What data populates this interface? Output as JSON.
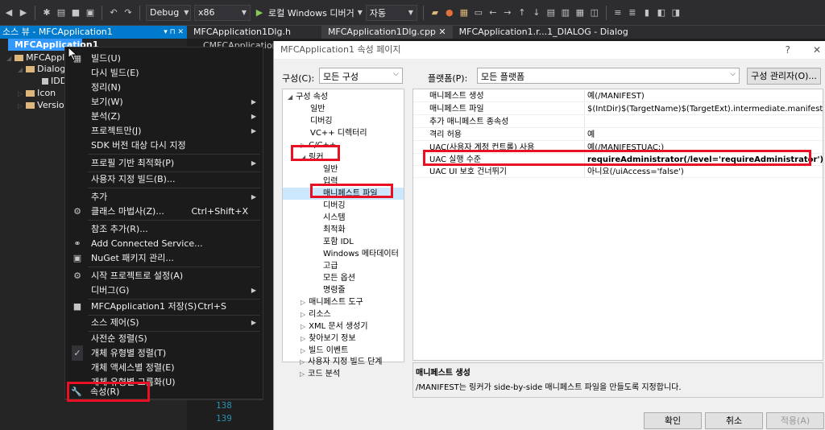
{
  "toolbar": {
    "config": "Debug",
    "platform": "x86",
    "run_label": "로컬 Windows 디버거",
    "run_mode": "자동"
  },
  "solution_explorer": {
    "title": "소스 뷰 - MFCApplication1",
    "items": [
      {
        "label": "MFCApplication1"
      },
      {
        "label": "MFCApplic"
      },
      {
        "label": "Dialog"
      },
      {
        "label": "IDD"
      },
      {
        "label": "Icon"
      },
      {
        "label": "Version"
      }
    ]
  },
  "tabs": [
    {
      "label": "MFCApplication1Dlg.h"
    },
    {
      "label": "MFCApplication1Dlg.cpp"
    },
    {
      "label": "MFCApplication1.r...1_DIALOG - Dialog"
    }
  ],
  "editor": {
    "line_a": "138",
    "line_b": "139",
    "partial_tab": "CMFCApplication1"
  },
  "context_menu": {
    "items": [
      {
        "label": "빌드(U)"
      },
      {
        "label": "다시 빌드(E)"
      },
      {
        "label": "정리(N)"
      },
      {
        "label": "보기(W)"
      },
      {
        "label": "분석(Z)"
      },
      {
        "label": "프로젝트만(J)"
      },
      {
        "label": "SDK 버전 대상 다시 지정"
      },
      {
        "label": "프로필 기반 최적화(P)"
      },
      {
        "label": "사용자 지정 빌드(B)..."
      },
      {
        "label": "추가"
      },
      {
        "label": "클래스 마법사(Z)...",
        "shortcut": "Ctrl+Shift+X"
      },
      {
        "label": "참조 추가(R)..."
      },
      {
        "label": "Add Connected Service..."
      },
      {
        "label": "NuGet 패키지 관리..."
      },
      {
        "label": "시작 프로젝트로 설정(A)"
      },
      {
        "label": "디버그(G)"
      },
      {
        "label": "MFCApplication1 저장(S)",
        "shortcut": "Ctrl+S"
      },
      {
        "label": "소스 제어(S)"
      },
      {
        "label": "사전순 정렬(S)"
      },
      {
        "label": "개체 유형별 정렬(T)"
      },
      {
        "label": "개체 액세스별 정렬(E)"
      },
      {
        "label": "개체 유형별 그룹화(U)"
      },
      {
        "label": "속성(R)"
      }
    ]
  },
  "dialog": {
    "title": "MFCApplication1 속성 페이지",
    "help": "?",
    "close": "✕",
    "config_label": "구성(C):",
    "config_value": "모든 구성",
    "platform_label": "플랫폼(P):",
    "platform_value": "모든 플랫폼",
    "config_manager": "구성 관리자(O)...",
    "tree": [
      "구성 속성",
      "일반",
      "디버깅",
      "VC++ 디렉터리",
      "C/C++",
      "링커",
      "일반",
      "입력",
      "매니페스트 파일",
      "디버깅",
      "시스템",
      "최적화",
      "포함 IDL",
      "Windows 메타데이터",
      "고급",
      "모든 옵션",
      "명령줄",
      "매니페스트 도구",
      "리소스",
      "XML 문서 생성기",
      "찾아보기 정보",
      "빌드 이벤트",
      "사용자 지정 빌드 단계",
      "코드 분석"
    ],
    "grid": [
      {
        "k": "매니페스트 생성",
        "v": "예(/MANIFEST)"
      },
      {
        "k": "매니페스트 파일",
        "v": "$(IntDir)$(TargetName)$(TargetExt).intermediate.manifest"
      },
      {
        "k": "추가 매니페스트 종속성",
        "v": ""
      },
      {
        "k": "격리 허용",
        "v": "예"
      },
      {
        "k": "UAC(사용자 계정 컨트롤) 사용",
        "v": "예(/MANIFESTUAC:)"
      },
      {
        "k": "UAC 실행 수준",
        "v": "requireAdministrator(/level='requireAdministrator')"
      },
      {
        "k": "UAC UI 보호 건너뛰기",
        "v": "아니요(/uiAccess='false')"
      }
    ],
    "desc_title": "매니페스트 생성",
    "desc_text": "/MANIFEST는 링커가 side-by-side 매니페스트 파일을 만들도록 지정합니다.",
    "ok": "확인",
    "cancel": "취소",
    "apply": "적용(A)"
  },
  "colors": {
    "highlight": "#e81123",
    "accent": "#007acc"
  }
}
